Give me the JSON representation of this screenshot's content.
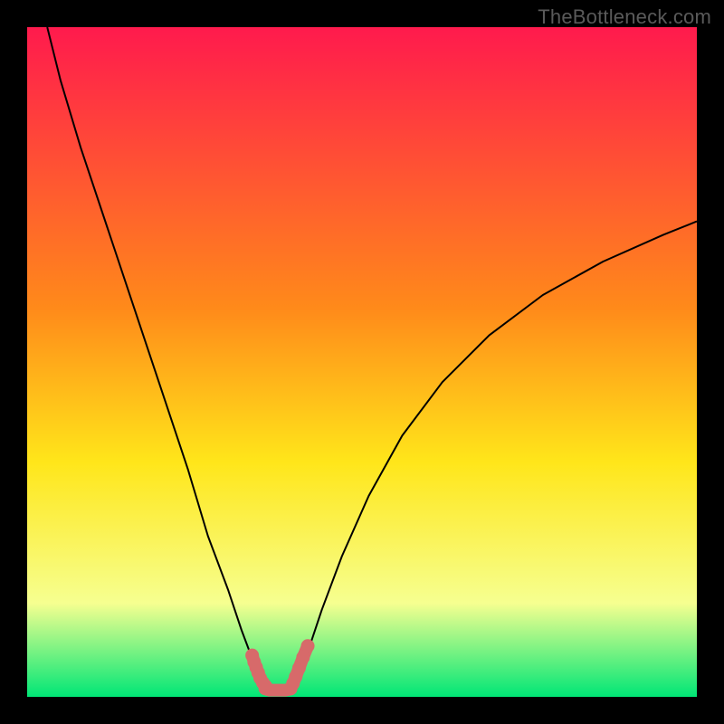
{
  "watermark": "TheBottleneck.com",
  "chart_data": {
    "type": "line",
    "title": "",
    "xlabel": "",
    "ylabel": "",
    "xlim": [
      0,
      100
    ],
    "ylim": [
      0,
      100
    ],
    "grid": false,
    "legend": false,
    "background_gradient": {
      "top": "#ff1a4d",
      "mid_upper": "#ff8a1a",
      "mid": "#ffe61a",
      "lower": "#f6ff90",
      "bottom": "#00e676"
    },
    "series": [
      {
        "name": "left-branch",
        "x": [
          3,
          5,
          8,
          12,
          16,
          20,
          24,
          27,
          30,
          32,
          33.5,
          34.5,
          35.2,
          35.8
        ],
        "y": [
          100,
          92,
          82,
          70,
          58,
          46,
          34,
          24,
          16,
          10,
          6,
          3.5,
          2,
          1.2
        ],
        "stroke": "#000000",
        "width": 2
      },
      {
        "name": "right-branch",
        "x": [
          39.5,
          40.5,
          42,
          44,
          47,
          51,
          56,
          62,
          69,
          77,
          86,
          95,
          100
        ],
        "y": [
          1.2,
          3,
          7,
          13,
          21,
          30,
          39,
          47,
          54,
          60,
          65,
          69,
          71
        ],
        "stroke": "#000000",
        "width": 2
      },
      {
        "name": "highlight-left-descent",
        "x": [
          33.6,
          33.9,
          34.2,
          34.5,
          34.8,
          35.2,
          35.6
        ],
        "y": [
          6.2,
          5.2,
          4.4,
          3.6,
          2.8,
          2.1,
          1.6
        ],
        "stroke": "#d76a6a",
        "width": 14,
        "linecap": "round"
      },
      {
        "name": "highlight-floor",
        "x": [
          35.5,
          36.2,
          37.0,
          37.8,
          38.6,
          39.4
        ],
        "y": [
          1.2,
          1.0,
          1.0,
          1.0,
          1.0,
          1.2
        ],
        "stroke": "#d76a6a",
        "width": 14,
        "linecap": "round"
      },
      {
        "name": "highlight-right-ascent",
        "x": [
          39.3,
          39.7,
          40.1,
          40.6,
          41.2,
          41.9
        ],
        "y": [
          1.2,
          2.0,
          3.0,
          4.3,
          5.9,
          7.6
        ],
        "stroke": "#d76a6a",
        "width": 14,
        "linecap": "round"
      }
    ]
  }
}
